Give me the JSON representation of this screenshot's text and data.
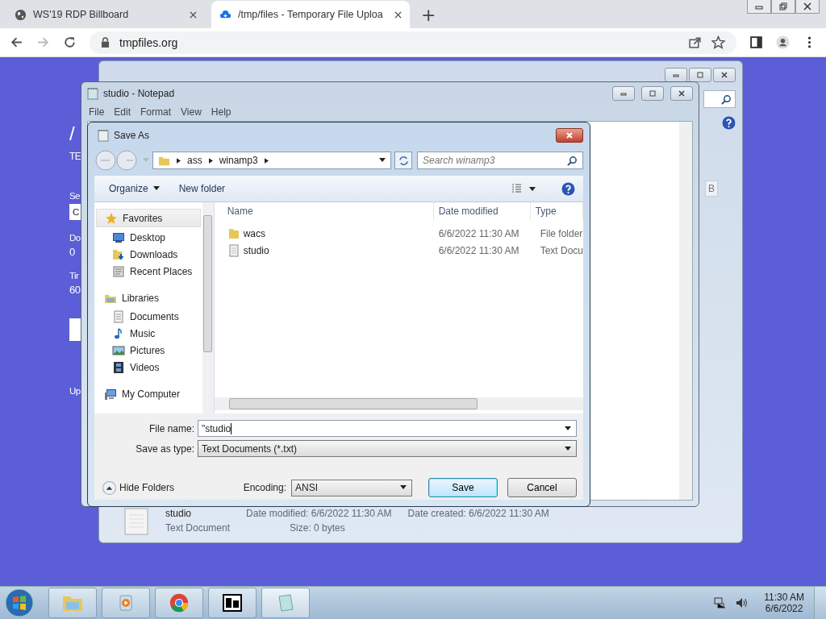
{
  "browser": {
    "tabs": [
      {
        "title": "WS'19 RDP Billboard",
        "selected": false
      },
      {
        "title": "/tmp/files - Temporary File Uploa",
        "selected": true
      }
    ],
    "new_tab": "+",
    "url": "tmpfiles.org"
  },
  "page": {
    "heading": "/",
    "subtitle": "TE",
    "fields": [
      {
        "label": "Se",
        "value": "C",
        "kind": "input"
      },
      {
        "label": "Do",
        "value": "0",
        "kind": "text"
      },
      {
        "label": "Tir",
        "value": "60",
        "kind": "text"
      }
    ],
    "footer": "Up"
  },
  "background_window": {
    "side_button": "B",
    "details": {
      "name": "studio",
      "date_modified": "Date modified: 6/6/2022 11:30 AM",
      "date_created": "Date created: 6/6/2022 11:30 AM",
      "type": "Text Document",
      "size": "Size: 0 bytes"
    }
  },
  "notepad": {
    "title": "studio - Notepad",
    "menu": [
      "File",
      "Edit",
      "Format",
      "View",
      "Help"
    ]
  },
  "save_dialog": {
    "title": "Save As",
    "path": [
      "ass",
      "winamp3"
    ],
    "search_placeholder": "Search winamp3",
    "toolbar": [
      "Organize",
      "New folder"
    ],
    "nav": [
      {
        "label": "Favorites",
        "selected": true,
        "children": [
          {
            "label": "Desktop",
            "kind": "desktop"
          },
          {
            "label": "Downloads",
            "kind": "downloads"
          },
          {
            "label": "Recent Places",
            "kind": "recent"
          }
        ]
      },
      {
        "label": "Libraries",
        "selected": false,
        "children": [
          {
            "label": "Documents",
            "kind": "documents"
          },
          {
            "label": "Music",
            "kind": "music"
          },
          {
            "label": "Pictures",
            "kind": "pictures"
          },
          {
            "label": "Videos",
            "kind": "videos"
          }
        ]
      },
      {
        "label": "My Computer",
        "selected": false
      }
    ],
    "columns": [
      "Name",
      "Date modified",
      "Type"
    ],
    "rows": [
      {
        "name": "wacs",
        "kind": "folder",
        "date": "6/6/2022 11:30 AM",
        "type": "File folder"
      },
      {
        "name": "studio",
        "kind": "file",
        "date": "6/6/2022 11:30 AM",
        "type": "Text Docu"
      }
    ],
    "file_name_label": "File name:",
    "file_name": "\"studio",
    "type_label": "Save as type:",
    "type_value": "Text Documents (*.txt)",
    "hide_folders": "Hide Folders",
    "encoding_label": "Encoding:",
    "encoding": "ANSI",
    "buttons": [
      "Save",
      "Cancel"
    ]
  },
  "taskbar": {
    "time": "11:30 AM",
    "date": "6/6/2022"
  }
}
